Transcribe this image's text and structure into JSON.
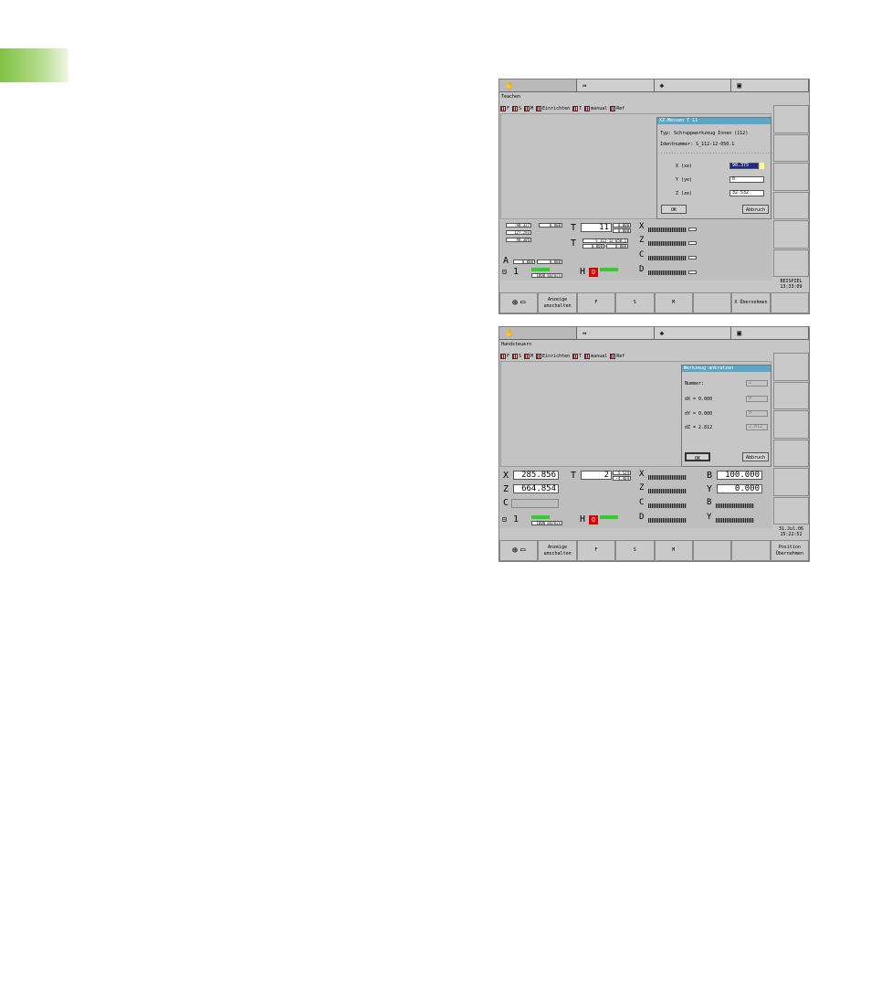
{
  "shot1": {
    "mode_title": "Teachen",
    "toolbar": [
      "F",
      "S",
      "M",
      "Einrichten",
      "T",
      "manual",
      "Ref"
    ],
    "dialog": {
      "title": "XZ-Messen T 11",
      "typ": "Typ: Schruppwerkzeug Innen  (112)",
      "ident": "Identnummer: S_112-12-050.1",
      "x_label": "X (xe)",
      "x_value": "98.375",
      "y_label": "Y (ye)",
      "y_value": "0",
      "z_label": "Z (ze)",
      "z_value": "32.532",
      "ok": "OK",
      "cancel": "Abbruch"
    },
    "status": {
      "t_value": "11",
      "t_sub1": "0.000",
      "t_sub2": "0.000",
      "tool_id": "S_112-12-050.1",
      "tool_sub1": "0.000",
      "tool_sub2": "0.000",
      "left_vals": [
        "-98.327",
        "127.293",
        "98.305"
      ],
      "a_val1": "0.000",
      "a_val2": "0.000",
      "spindle_num": "1",
      "feed": "1000 mm/min",
      "axes": [
        "X",
        "Z",
        "C",
        "D"
      ]
    },
    "info": [
      "BEISPIEL",
      "13:33:09"
    ],
    "softkeys": [
      "",
      "Anzeige umschalten",
      "F",
      "S",
      "M",
      "",
      "X Übernehmen"
    ]
  },
  "shot2": {
    "mode_title": "Handsteuern",
    "toolbar": [
      "F",
      "S",
      "M",
      "Einrichten",
      "T",
      "manual",
      "Ref"
    ],
    "dialog": {
      "title": "Werkzeug ankratzen",
      "nummer_label": "Nummer:",
      "nummer_value": "2",
      "dx_label": "dX = 0.000",
      "dx_value": "0",
      "dy_label": "dY = 0.000",
      "dy_value": "0",
      "dz_label": "dZ = 2.812",
      "dz_value": "2.812",
      "ok": "OK",
      "cancel": "Abbruch"
    },
    "status": {
      "x_label": "X",
      "x_value": "285.856",
      "z_label": "Z",
      "z_value": "664.854",
      "c_label": "C",
      "t_value": "2",
      "t_sub1": "5.524",
      "t_sub2": "-4.464",
      "b_label": "B",
      "b_value": "100.000",
      "y_label": "Y",
      "y_value": "0.000",
      "spindle_num": "1",
      "feed": "1000 mm/min"
    },
    "info": [
      "31.Jul.06",
      "15:22:52"
    ],
    "softkeys": [
      "",
      "Anzeige umschalten",
      "F",
      "S",
      "M",
      "",
      "",
      "Position Übernehmen"
    ]
  },
  "colors": {
    "accent_green": "#7fc241",
    "dialog_title": "#5aa6c7",
    "selected_field": "#1f2b8c"
  }
}
